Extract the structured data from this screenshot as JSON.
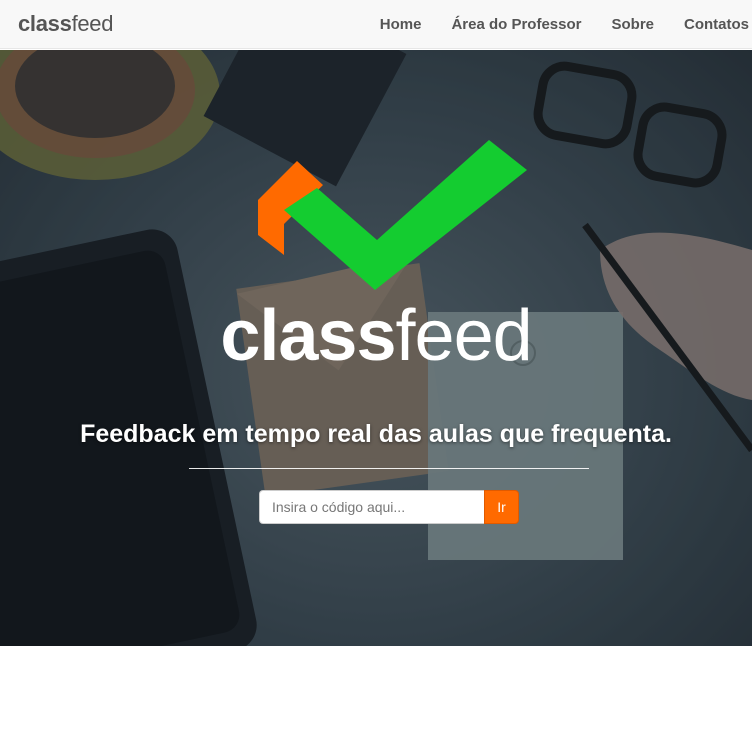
{
  "brand": {
    "part1": "class",
    "part2": "feed"
  },
  "nav": {
    "items": [
      {
        "label": "Home"
      },
      {
        "label": "Área do Professor"
      },
      {
        "label": "Sobre"
      },
      {
        "label": "Contatos"
      }
    ]
  },
  "hero": {
    "logo_part1": "class",
    "logo_part2": "feed",
    "tagline": "Feedback em tempo real das aulas que frequenta.",
    "search_placeholder": "Insira o código aqui...",
    "search_button": "Ir"
  },
  "colors": {
    "accent_orange": "#ff6a00",
    "check_green": "#14cc30",
    "navbar_bg": "#f8f8f8"
  }
}
